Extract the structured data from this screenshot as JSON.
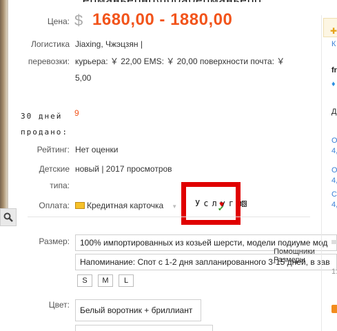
{
  "price": {
    "label": "Цена:",
    "currency": "$",
    "value": "1680,00 - 1880,00"
  },
  "logistics": {
    "label_line1": "Логистика",
    "label_line2": "перевозки:",
    "origin": "Jiaxing, Чжэцзян  |",
    "line2": "курьера: ￥ 22,00  EMS: ￥ 20,00  поверхности почта: ￥",
    "line3": "5,00"
  },
  "sold": {
    "label_line1": "30 дней",
    "count": "9",
    "label_line2": "продано:"
  },
  "rating": {
    "label": "Рейтинг:",
    "value": "Нет оценки"
  },
  "kids_type": {
    "label_line1": "Детские",
    "label_line2": "типа:",
    "value": "новый  |  2017 просмотров"
  },
  "payment": {
    "label": "Оплата:",
    "value": "Кредитная карточка",
    "services": "Услуги"
  },
  "size": {
    "label": "Размер:",
    "option1": "100% импортированных из козьей шерсти, модели подиуме мод",
    "option2": "Напоминание: Спот с 1-2 дня запланированного 3-15 дней, в зав",
    "buttons": [
      "S",
      "M",
      "L"
    ]
  },
  "tooltip": {
    "line1": "Помощники",
    "line2": "Размеры"
  },
  "color": {
    "label": "Цвет:",
    "option1": "Белый воротник + бриллиант"
  },
  "right_panel": {
    "top_char": "К",
    "line1": "fr",
    "line2": "Д",
    "line3": "О",
    "line4": "4,",
    "line5": "О",
    "line6": "4,",
    "line7": "С",
    "line8": "4,",
    "line9": "1:"
  },
  "colors": {
    "price": "#f2541b",
    "highlight": "#e00000",
    "link": "#3a7fd5"
  }
}
